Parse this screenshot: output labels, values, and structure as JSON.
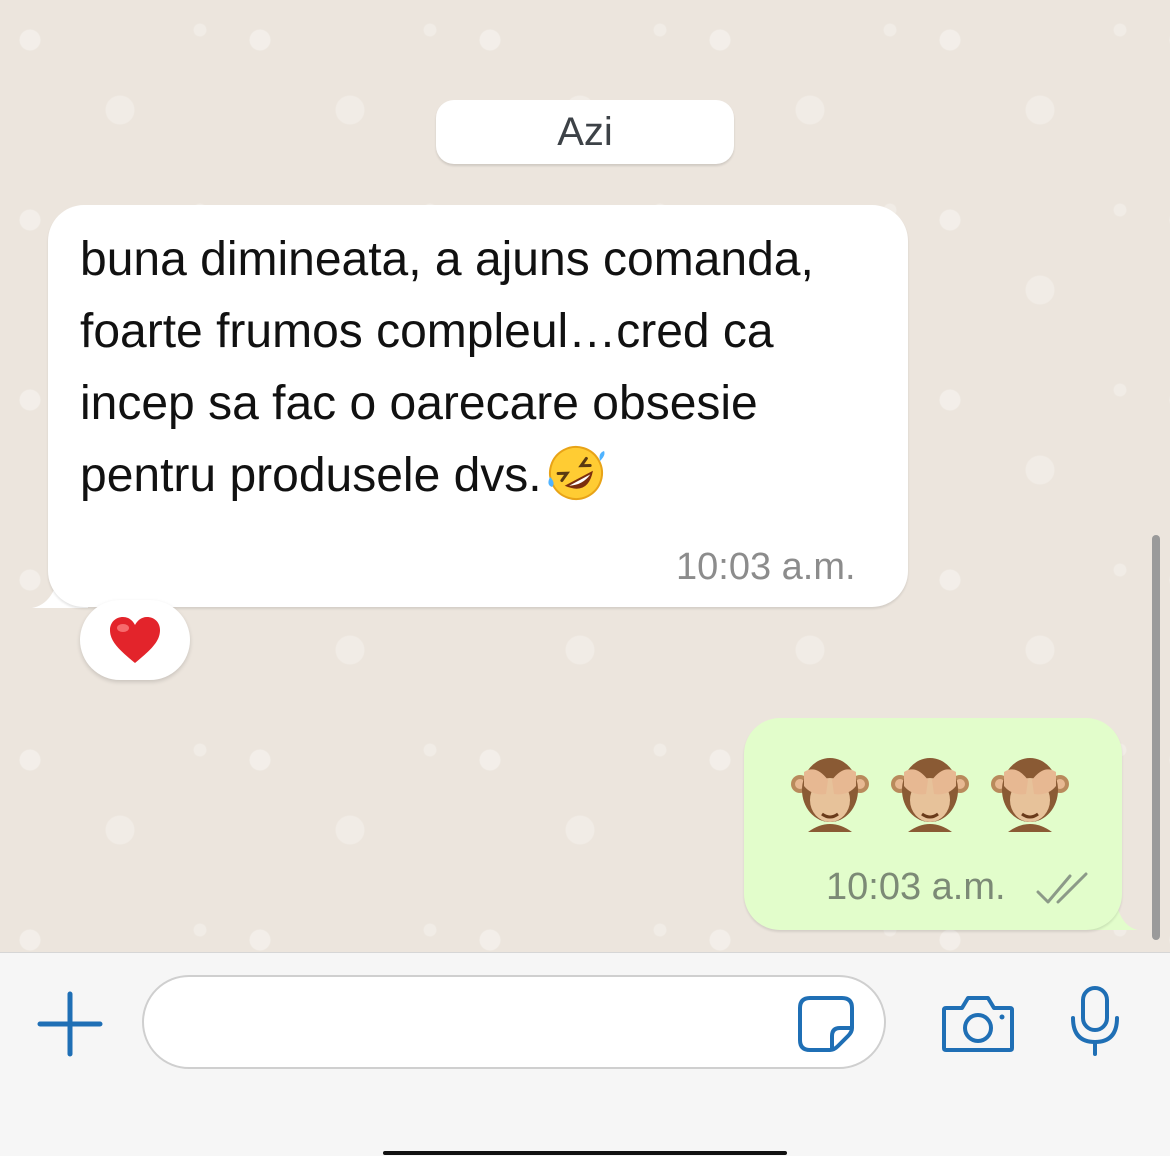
{
  "colors": {
    "chat_background": "#ece5dd",
    "incoming_bubble": "#ffffff",
    "outgoing_bubble": "#e2fdcb",
    "accent": "#1f6fb5",
    "timestamp_in": "#8c8c8c",
    "timestamp_out": "#7c8a76"
  },
  "chat": {
    "date_separator": "Azi",
    "messages": [
      {
        "direction": "incoming",
        "text": "buna dimineata, a ajuns comanda, foarte frumos compleul…cred ca incep sa fac o oarecare obsesie pentru produsele dvs.",
        "trailing_emoji": "rolling-on-floor-laughing",
        "time": "10:03 a.m.",
        "reaction": "red-heart"
      },
      {
        "direction": "outgoing",
        "emojis": [
          "see-no-evil-monkey",
          "see-no-evil-monkey",
          "see-no-evil-monkey"
        ],
        "time": "10:03 a.m.",
        "status": "delivered-double-check"
      }
    ]
  },
  "composer": {
    "text_value": "",
    "icons": [
      "plus-icon",
      "sticker-icon",
      "camera-icon",
      "microphone-icon"
    ]
  }
}
